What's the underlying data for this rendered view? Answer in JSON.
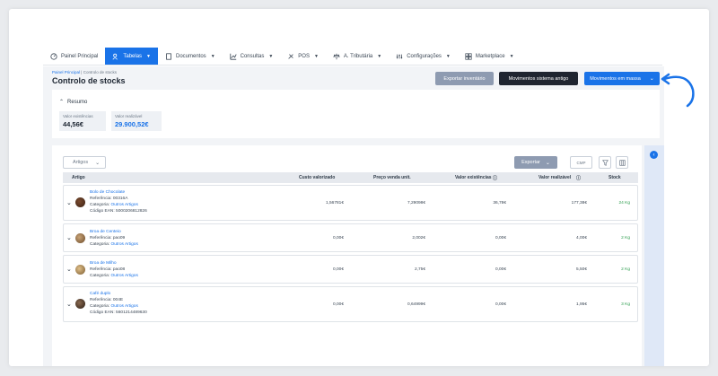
{
  "nav": [
    {
      "label": "Painel Principal",
      "icon": "dashboard-icon",
      "dropdown": false
    },
    {
      "label": "Tabelas",
      "icon": "people-icon",
      "dropdown": true,
      "active": true
    },
    {
      "label": "Documentos",
      "icon": "document-icon",
      "dropdown": true
    },
    {
      "label": "Consultas",
      "icon": "chart-icon",
      "dropdown": true
    },
    {
      "label": "POS",
      "icon": "pos-icon",
      "dropdown": true
    },
    {
      "label": "A. Tributária",
      "icon": "scale-icon",
      "dropdown": true
    },
    {
      "label": "Configurações",
      "icon": "settings-icon",
      "dropdown": true
    },
    {
      "label": "Marketplace",
      "icon": "store-icon",
      "dropdown": true
    }
  ],
  "breadcrumb": {
    "home": "Painel Principal",
    "sep": "|",
    "current": "Controlo de stocks"
  },
  "page_title": "Controlo de stocks",
  "actions": {
    "export_inventory": "Exportar inventário",
    "system_movements": "Movimentos sistema antigo",
    "bulk_movements": "Movimentos em massa"
  },
  "summary": {
    "title": "Resumo",
    "kpis": [
      {
        "label": "Valor existências",
        "value": "44,56€",
        "blue": false
      },
      {
        "label": "Valor realizável",
        "value": "29.900,52€",
        "blue": true
      }
    ]
  },
  "toolbar": {
    "filter_select": "Artigos",
    "export": "Exportar",
    "cmp": "CMP"
  },
  "columns": [
    "Artigo",
    "Custo valorizado",
    "Preço venda unit.",
    "Valor existências",
    "Valor realizável",
    "Stock"
  ],
  "rows": [
    {
      "name": "Bolo de Chocolate",
      "ref": "Referência: 00316A",
      "cat_label": "Categoria:",
      "cat": "Outros Artigos",
      "ean": "Código EAN: 5000206812826",
      "cost": "1,56781€",
      "price": "7,29098€",
      "stock_value": "36,78€",
      "realizable": "177,38€",
      "stock": "24 Kg"
    },
    {
      "name": "Broa de Centeio",
      "ref": "Referência: pao09",
      "cat_label": "Categoria:",
      "cat": "Outros Artigos",
      "ean": "",
      "cost": "0,00€",
      "price": "2,002€",
      "stock_value": "0,00€",
      "realizable": "4,00€",
      "stock": "2 Kg"
    },
    {
      "name": "Broa de Milho",
      "ref": "Referência: pao08",
      "cat_label": "Categoria:",
      "cat": "Outros Artigos",
      "ean": "",
      "cost": "0,00€",
      "price": "2,75€",
      "stock_value": "0,00€",
      "realizable": "5,50€",
      "stock": "2 Kg"
    },
    {
      "name": "Café duplo",
      "ref": "Referência: 004E",
      "cat_label": "Categoria:",
      "cat": "Outros Artigos",
      "ean": "Código EAN: 5601214489630",
      "cost": "0,00€",
      "price": "0,64999€",
      "stock_value": "0,00€",
      "realizable": "1,95€",
      "stock": "3 Kg"
    }
  ],
  "colors": {
    "accent": "#1a73e8",
    "dark": "#1f2530",
    "muted_button": "#8e9bb1",
    "stock_green": "#2e9e4f"
  }
}
